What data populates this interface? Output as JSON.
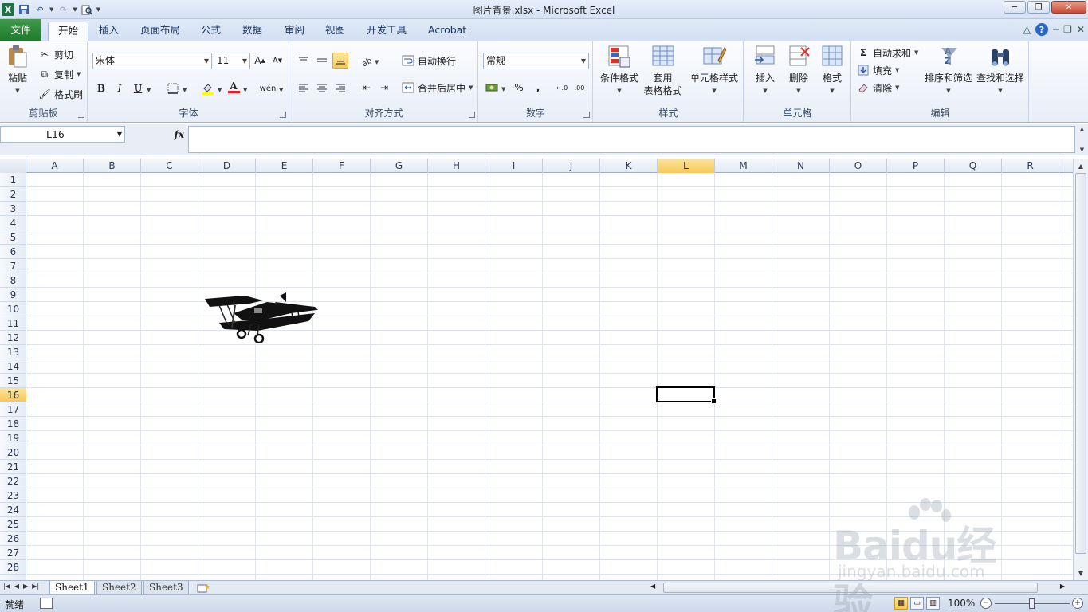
{
  "window": {
    "title": "图片背景.xlsx - Microsoft Excel"
  },
  "tabs": [
    {
      "label": "文件"
    },
    {
      "label": "开始"
    },
    {
      "label": "插入"
    },
    {
      "label": "页面布局"
    },
    {
      "label": "公式"
    },
    {
      "label": "数据"
    },
    {
      "label": "审阅"
    },
    {
      "label": "视图"
    },
    {
      "label": "开发工具"
    },
    {
      "label": "Acrobat"
    }
  ],
  "ribbon": {
    "clipboard": {
      "label": "剪贴板",
      "paste": "粘贴",
      "cut": "剪切",
      "copy": "复制",
      "format_painter": "格式刷"
    },
    "font": {
      "label": "字体",
      "font_name": "宋体",
      "font_size": "11",
      "bold": "B",
      "italic": "I",
      "underline": "U",
      "font_color_letter": "A"
    },
    "alignment": {
      "label": "对齐方式",
      "wrap_text": "自动换行",
      "merge_center": "合并后居中"
    },
    "number": {
      "label": "数字",
      "format": "常规",
      "percent": "%",
      "comma": ","
    },
    "styles": {
      "label": "样式",
      "conditional": "条件格式",
      "table_format_1": "套用",
      "table_format_2": "表格格式",
      "cell_styles": "单元格样式"
    },
    "cells": {
      "label": "单元格",
      "insert": "插入",
      "delete": "删除",
      "format": "格式"
    },
    "editing": {
      "label": "编辑",
      "autosum": "自动求和",
      "fill": "填充",
      "clear": "清除",
      "sort_filter": "排序和筛选",
      "find_select": "查找和选择"
    }
  },
  "formula_bar": {
    "name_box": "L16",
    "fx": "fx",
    "value": ""
  },
  "columns": [
    "A",
    "B",
    "C",
    "D",
    "E",
    "F",
    "G",
    "H",
    "I",
    "J",
    "K",
    "L",
    "M",
    "N",
    "O",
    "P",
    "Q",
    "R"
  ],
  "rows": [
    "1",
    "2",
    "3",
    "4",
    "5",
    "6",
    "7",
    "8",
    "9",
    "10",
    "11",
    "12",
    "13",
    "14",
    "15",
    "16",
    "17",
    "18",
    "19",
    "20",
    "21",
    "22",
    "23",
    "24",
    "25",
    "26",
    "27",
    "28"
  ],
  "active_column": "L",
  "active_row": "16",
  "sheets": [
    {
      "name": "Sheet1"
    },
    {
      "name": "Sheet2"
    },
    {
      "name": "Sheet3"
    }
  ],
  "status": {
    "text": "就绪",
    "zoom": "100%"
  },
  "watermark": {
    "brand": "Baidu经验",
    "url": "jingyan.baidu.com"
  },
  "colors": {
    "file_tab": "#1f7a2c",
    "active_header": "#f7c75a",
    "ribbon_bg": "#e8eef8"
  }
}
